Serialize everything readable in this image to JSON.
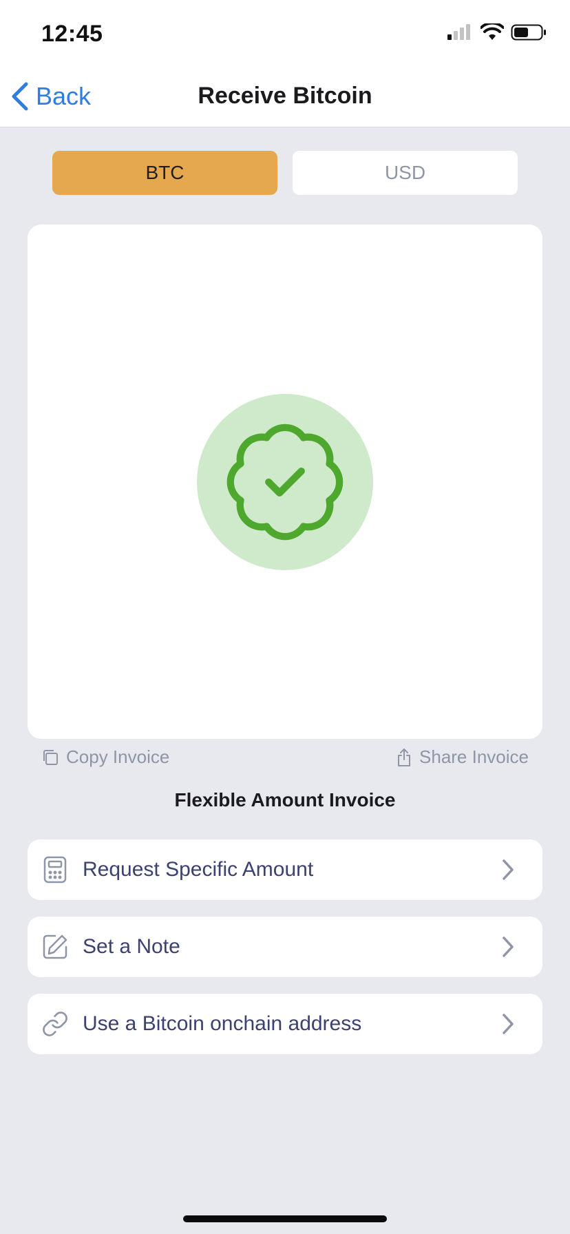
{
  "status_bar": {
    "time": "12:45"
  },
  "nav": {
    "back_label": "Back",
    "title": "Receive Bitcoin"
  },
  "currency_toggle": {
    "btc_label": "BTC",
    "usd_label": "USD",
    "selected": "BTC"
  },
  "invoice": {
    "copy_label": "Copy Invoice",
    "share_label": "Share Invoice",
    "type_label": "Flexible Amount Invoice"
  },
  "options": [
    {
      "label": "Request Specific Amount",
      "icon": "calculator-icon"
    },
    {
      "label": "Set a Note",
      "icon": "edit-note-icon"
    },
    {
      "label": "Use a Bitcoin onchain address",
      "icon": "link-icon"
    }
  ],
  "colors": {
    "accent_btc": "#e6a84e",
    "link_blue": "#2f7de1",
    "success_green": "#4ea82e",
    "success_bg": "#cfeacb",
    "background": "#e7e9ee"
  }
}
